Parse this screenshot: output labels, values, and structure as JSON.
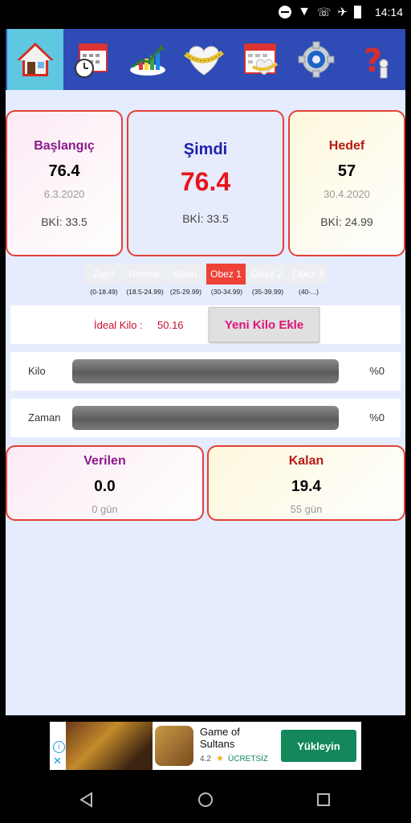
{
  "status": {
    "time": "14:14"
  },
  "cards": {
    "start": {
      "title": "Başlangıç",
      "weight": "76.4",
      "date": "6.3.2020",
      "bki": "BKİ: 33.5"
    },
    "now": {
      "title": "Şimdi",
      "weight": "76.4",
      "bki": "BKİ: 33.5"
    },
    "target": {
      "title": "Hedef",
      "weight": "57",
      "date": "30.4.2020",
      "bki": "BKİ: 24.99"
    }
  },
  "bmi": [
    {
      "label": "Zayıf",
      "range": "(0-18.49)"
    },
    {
      "label": "Normal",
      "range": "(18.5-24.99)"
    },
    {
      "label": "Kilolu",
      "range": "(25-29.99)"
    },
    {
      "label": "Obez 1",
      "range": "(30-34.99)",
      "active": true
    },
    {
      "label": "Obez 2",
      "range": "(35-39.99)"
    },
    {
      "label": "Obez 3",
      "range": "(40-...)"
    }
  ],
  "ideal": {
    "label": "İdeal Kilo :",
    "value": "50.16",
    "button": "Yeni Kilo Ekle"
  },
  "progress": {
    "kilo": {
      "label": "Kilo",
      "percent": "%0",
      "fraction": 0
    },
    "zaman": {
      "label": "Zaman",
      "percent": "%0",
      "fraction": 0
    }
  },
  "summary": {
    "given": {
      "title": "Verilen",
      "value": "0.0",
      "days": "0 gün"
    },
    "left": {
      "title": "Kalan",
      "value": "19.4",
      "days": "55 gün"
    }
  },
  "ad": {
    "title_line1": "Game of",
    "title_line2": "Sultans",
    "rating": "4.2",
    "badge": "ÜCRETSİZ",
    "button": "Yükleyin"
  },
  "colors": {
    "navbar": "#2f4bb6",
    "nav_active": "#5fc7e0",
    "card_border": "#e34037",
    "now_value": "#e8141c",
    "bmi_active": "#ee4237",
    "ad_button": "#14885a"
  },
  "icons": [
    "home-icon",
    "calendar-clock-icon",
    "chart-growth-icon",
    "heart-measure-icon",
    "calendar-heart-icon",
    "gear-icon",
    "help-question-icon"
  ]
}
